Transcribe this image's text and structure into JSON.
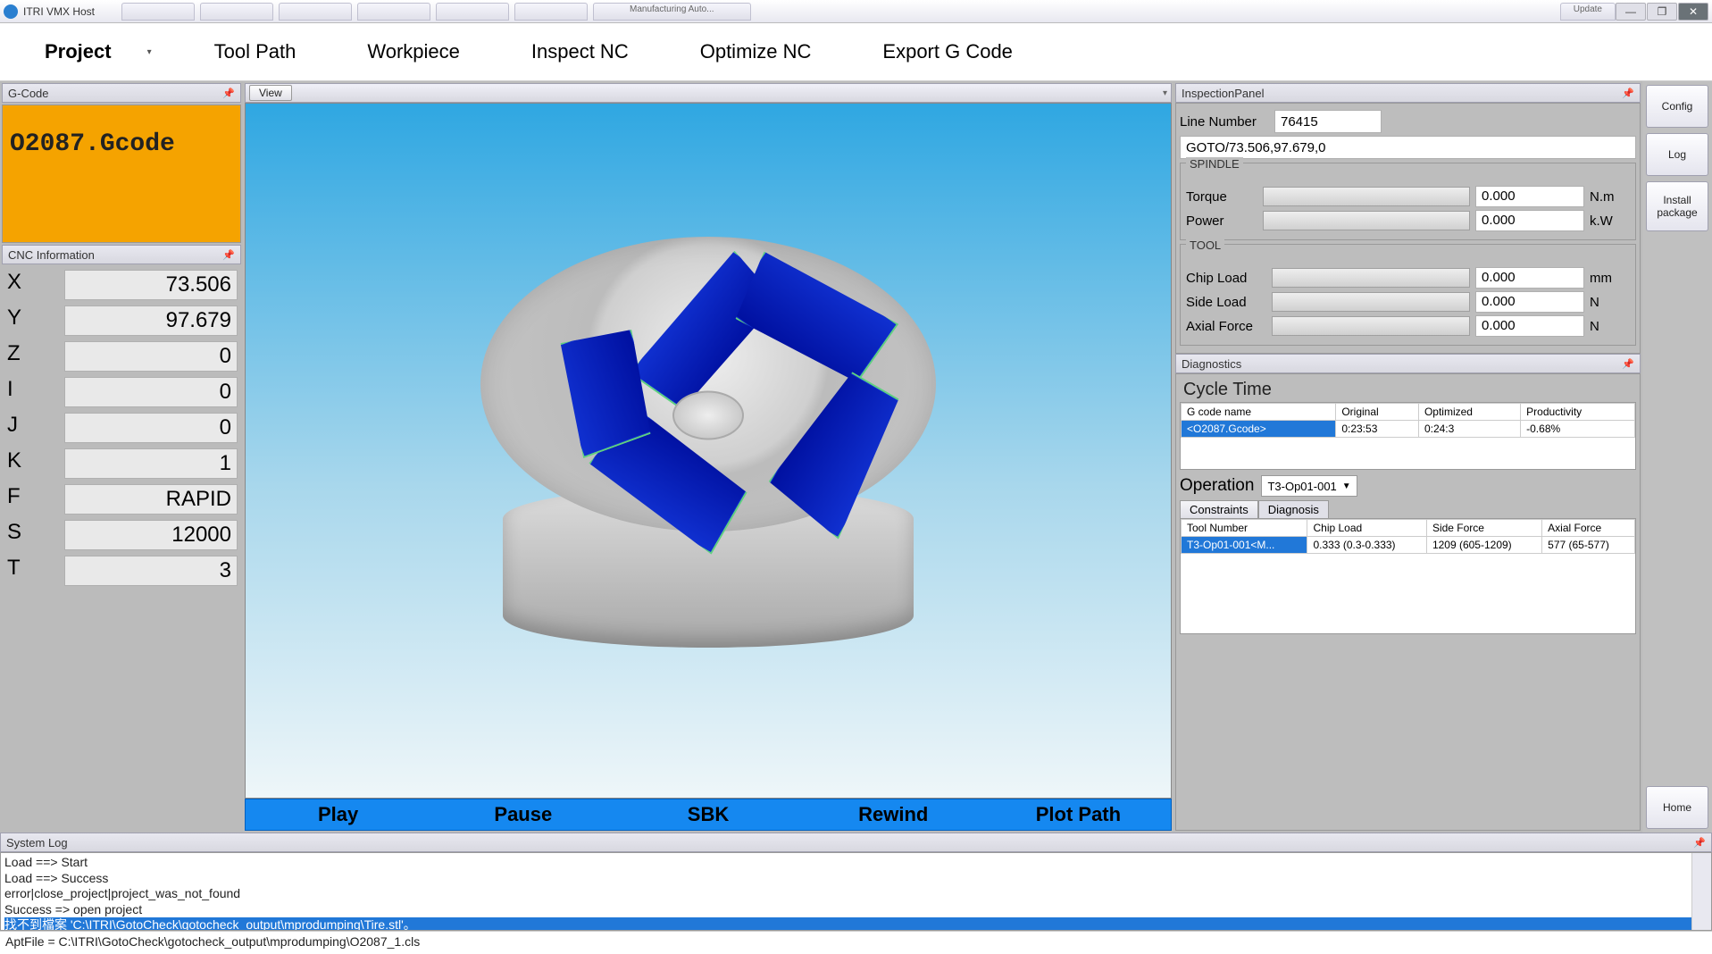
{
  "window": {
    "title": "ITRI VMX Host",
    "browserTabs": [
      "",
      "",
      "",
      "",
      "",
      "",
      "Manufacturing Auto..."
    ],
    "updateBtn": "Update"
  },
  "menu": {
    "items": [
      "Project",
      "Tool Path",
      "Workpiece",
      "Inspect NC",
      "Optimize NC",
      "Export G Code"
    ]
  },
  "sideButtons": {
    "config": "Config",
    "log": "Log",
    "install": "Install package",
    "home": "Home"
  },
  "gcode": {
    "panelTitle": "G-Code",
    "filename": "O2087.Gcode"
  },
  "cnc": {
    "panelTitle": "CNC Information",
    "rows": [
      {
        "label": "X",
        "value": "73.506"
      },
      {
        "label": "Y",
        "value": "97.679"
      },
      {
        "label": "Z",
        "value": "0"
      },
      {
        "label": "I",
        "value": "0"
      },
      {
        "label": "J",
        "value": "0"
      },
      {
        "label": "K",
        "value": "1"
      },
      {
        "label": "F",
        "value": "RAPID"
      },
      {
        "label": "S",
        "value": "12000"
      },
      {
        "label": "T",
        "value": "3"
      }
    ]
  },
  "view": {
    "viewBtn": "View",
    "playbar": [
      "Play",
      "Pause",
      "SBK",
      "Rewind",
      "Plot Path"
    ]
  },
  "inspection": {
    "panelTitle": "InspectionPanel",
    "lineNumberLabel": "Line Number",
    "lineNumber": "76415",
    "command": "GOTO/73.506,97.679,0",
    "spindleTitle": "SPINDLE",
    "torqueLabel": "Torque",
    "torqueVal": "0.000",
    "torqueUnit": "N.m",
    "powerLabel": "Power",
    "powerVal": "0.000",
    "powerUnit": "k.W",
    "toolTitle": "TOOL",
    "chipLabel": "Chip Load",
    "chipVal": "0.000",
    "chipUnit": "mm",
    "sideLabel": "Side Load",
    "sideVal": "0.000",
    "sideUnit": "N",
    "axialLabel": "Axial Force",
    "axialVal": "0.000",
    "axialUnit": "N"
  },
  "diag": {
    "panelTitle": "Diagnostics",
    "cycleHeader": "Cycle Time",
    "cycleCols": [
      "G code name",
      "Original",
      "Optimized",
      "Productivity"
    ],
    "cycleRow": [
      "<O2087.Gcode>",
      "0:23:53",
      "0:24:3",
      "-0.68%"
    ],
    "operationLabel": "Operation",
    "operationValue": "T3-Op01-001",
    "tabs": [
      "Constraints",
      "Diagnosis"
    ],
    "opCols": [
      "Tool Number",
      "Chip Load",
      "Side Force",
      "Axial Force"
    ],
    "opRow": [
      "T3-Op01-001<M...",
      "0.333 (0.3-0.333)",
      "1209 (605-1209)",
      "577 (65-577)"
    ]
  },
  "syslog": {
    "panelTitle": "System Log",
    "lines": [
      "Load ==> Start",
      "Load ==> Success",
      "error|close_project|project_was_not_found",
      "Success => open project"
    ],
    "highlight": "找不到檔案 'C:\\ITRI\\GotoCheck\\gotocheck_output\\mprodumping\\Tire.stl'。"
  },
  "status": "AptFile = C:\\ITRI\\GotoCheck\\gotocheck_output\\mprodumping\\O2087_1.cls"
}
